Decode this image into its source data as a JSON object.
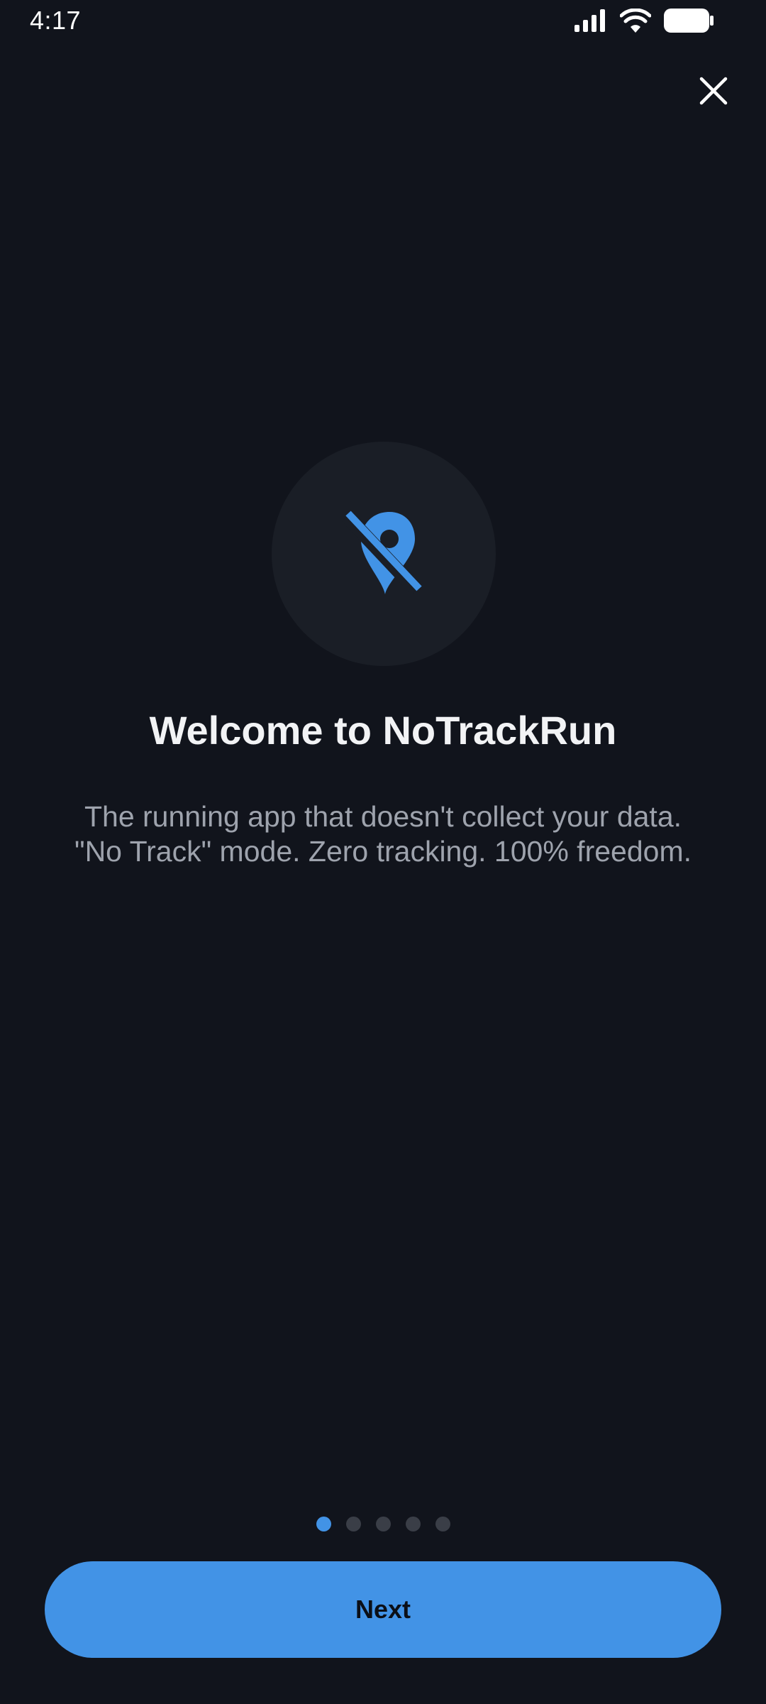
{
  "status_bar": {
    "time": "4:17",
    "icons": [
      "signal-icon",
      "wifi-icon",
      "battery-icon"
    ]
  },
  "header": {
    "close_icon": "close-icon"
  },
  "hero": {
    "icon": "location-off-icon",
    "accent_color": "#4293e6",
    "circle_color": "#1a1e26"
  },
  "content": {
    "title": "Welcome to NoTrackRun",
    "subtitle_lines": [
      "The running app that doesn't collect your data.",
      "\"No Track\" mode. Zero tracking. 100% freedom."
    ]
  },
  "pagination": {
    "current": 1,
    "total": 5,
    "active_color": "#4293e6",
    "inactive_color": "#3a3e47"
  },
  "footer": {
    "next_label": "Next",
    "button_color": "#4293e6"
  },
  "theme": {
    "background": "#11141c"
  }
}
